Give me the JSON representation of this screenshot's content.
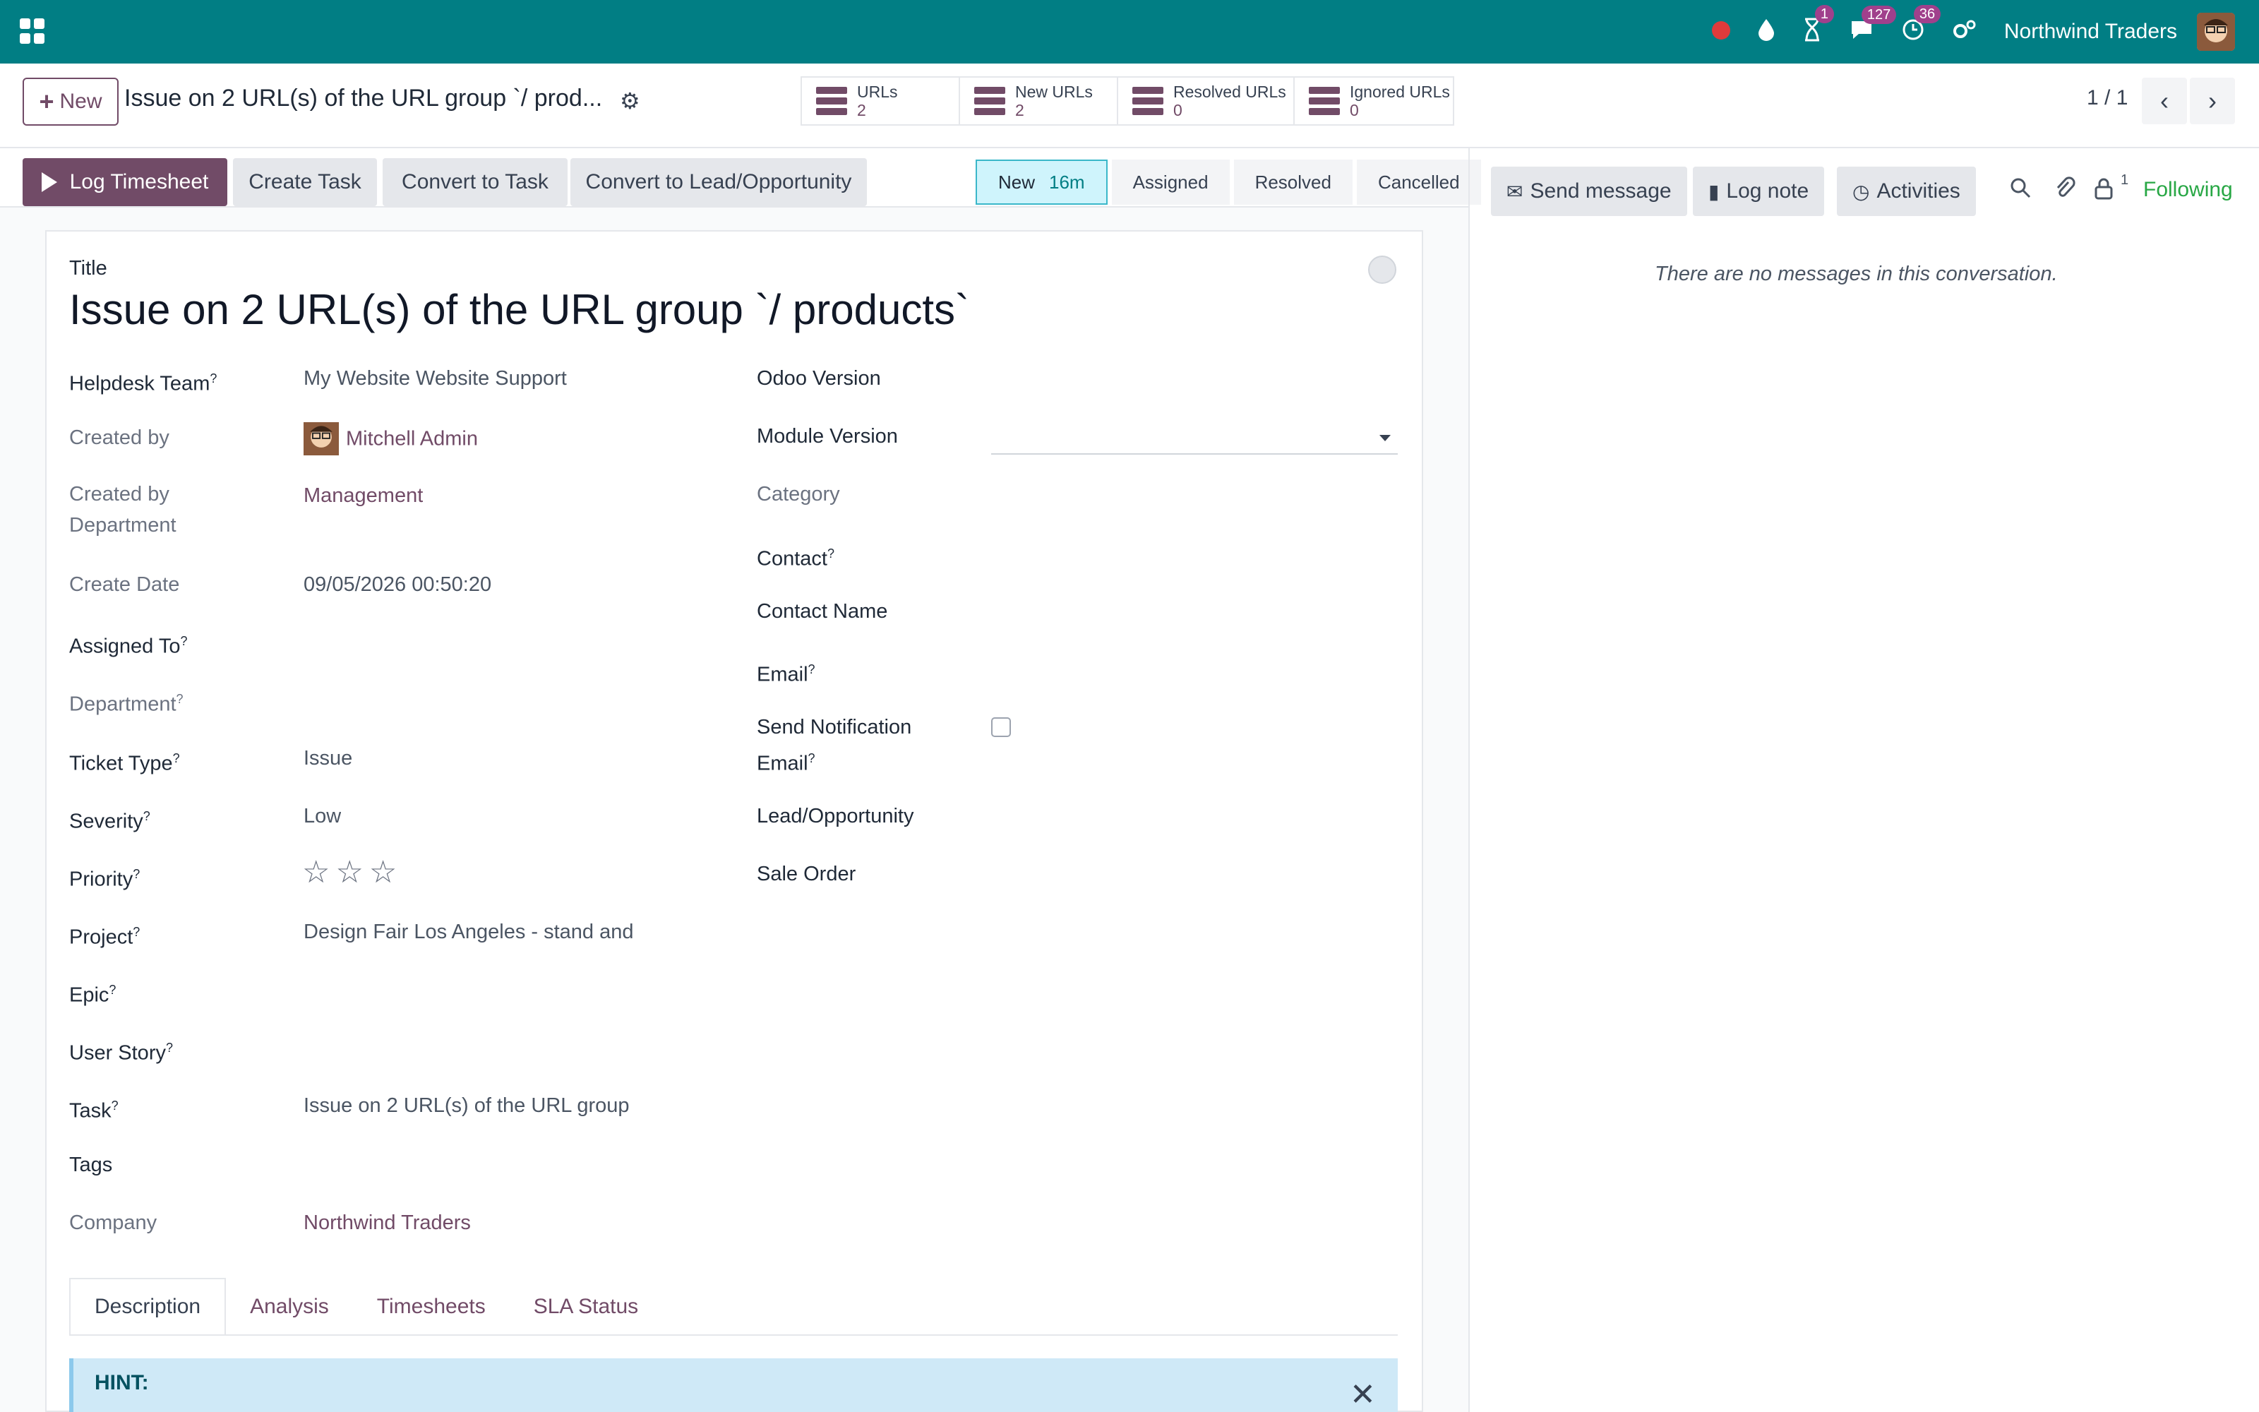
{
  "topbar": {
    "company": "Northwind Traders",
    "icons": {
      "recording": "red-dot-icon",
      "drop": "drop-icon",
      "activity_badge": "1",
      "messages_badge": "127",
      "clock_badge": "36"
    }
  },
  "control": {
    "new_label": "New",
    "record_title": "Issue on 2 URL(s) of the URL group `/ prod...",
    "smart_buttons": [
      {
        "label": "URLs",
        "value": "2"
      },
      {
        "label": "New URLs",
        "value": "2"
      },
      {
        "label": "Resolved URLs",
        "value": "0"
      },
      {
        "label": "Ignored URLs",
        "value": "0"
      }
    ],
    "pager": "1 / 1"
  },
  "actions": {
    "log_timesheet": "Log Timesheet",
    "create_task": "Create Task",
    "convert_task": "Convert to Task",
    "convert_lead": "Convert to Lead/Opportunity"
  },
  "stages": [
    {
      "label": "New",
      "duration": "16m"
    },
    {
      "label": "Assigned"
    },
    {
      "label": "Resolved"
    },
    {
      "label": "Cancelled"
    }
  ],
  "form": {
    "title_label": "Title",
    "title_value": "Issue on 2 URL(s) of the URL group `/ products`",
    "left": {
      "helpdesk_team": {
        "label": "Helpdesk Team",
        "value": "My Website Website Support"
      },
      "created_by": {
        "label": "Created by",
        "value": "Mitchell Admin"
      },
      "created_by_dept": {
        "label1": "Created by",
        "label2": "Department",
        "value": "Management"
      },
      "create_date": {
        "label": "Create Date",
        "value": "09/05/2026 00:50:20"
      },
      "assigned_to": {
        "label": "Assigned To"
      },
      "department": {
        "label": "Department"
      },
      "ticket_type": {
        "label": "Ticket Type",
        "value": "Issue"
      },
      "severity": {
        "label": "Severity",
        "value": "Low"
      },
      "priority": {
        "label": "Priority",
        "stars": 0,
        "max": 3
      },
      "project": {
        "label": "Project",
        "value": "Design Fair Los Angeles - stand and"
      },
      "epic": {
        "label": "Epic"
      },
      "user_story": {
        "label": "User Story"
      },
      "task": {
        "label": "Task",
        "value": "Issue on 2 URL(s) of the URL group"
      },
      "tags": {
        "label": "Tags"
      },
      "company": {
        "label": "Company",
        "value": "Northwind Traders"
      }
    },
    "right": {
      "odoo_version": {
        "label": "Odoo Version"
      },
      "module_version": {
        "label": "Module Version"
      },
      "category": {
        "label": "Category"
      },
      "contact": {
        "label": "Contact"
      },
      "contact_name": {
        "label": "Contact Name"
      },
      "email": {
        "label": "Email"
      },
      "send_notif": {
        "label1": "Send Notification",
        "label2": "Email"
      },
      "lead": {
        "label": "Lead/Opportunity"
      },
      "sale_order": {
        "label": "Sale Order"
      }
    },
    "tooltip_mark": "?",
    "tabs": [
      "Description",
      "Analysis",
      "Timesheets",
      "SLA Status"
    ],
    "hint": "HINT:"
  },
  "chatter": {
    "send_message": "Send message",
    "log_note": "Log note",
    "activities": "Activities",
    "followers_count": "1",
    "following": "Following",
    "empty": "There are no messages in this conversation."
  },
  "colors": {
    "topbar": "#017e84",
    "brand": "#714b67",
    "following": "#28a745"
  }
}
